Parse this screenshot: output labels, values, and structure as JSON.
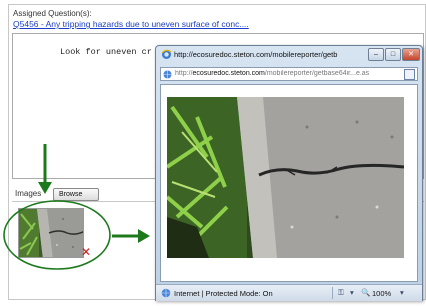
{
  "form": {
    "assigned_label": "Assigned Question(s):",
    "question_link": "Q5456 - Any tripping hazards due to uneven surface of conc....",
    "notes_text": "Look for uneven cr",
    "images_label": "Images",
    "browse_label": "Browse"
  },
  "popup": {
    "title": "http://ecosuredoc.steton.com/mobilereporter/getb",
    "minimize_label": "–",
    "maximize_label": "□",
    "close_label": "✕",
    "address_prefix": "http://",
    "address_domain": "ecosuredoc.steton.com",
    "address_path": "/mobilereporter/getbase64ir...e.as",
    "status_zone": "Internet | Protected Mode: On",
    "zoom": "100%",
    "dropdown_glyph": "▾"
  },
  "icons": {
    "delete": "✕"
  },
  "colors": {
    "link": "#1a3ec8",
    "annotation_green": "#1c7a1c",
    "delete_red": "#d21b1b"
  }
}
